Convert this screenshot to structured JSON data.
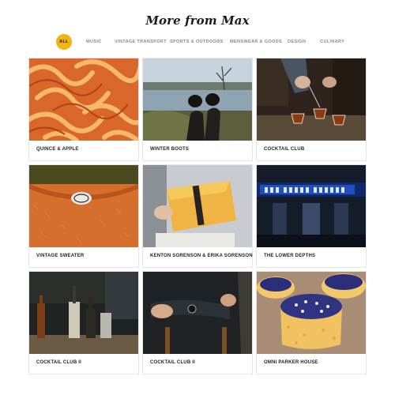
{
  "page": {
    "title": "More from Max"
  },
  "filters": [
    {
      "label": "All",
      "active": true
    },
    {
      "label": "Music",
      "active": false
    },
    {
      "label": "Vintage Transport",
      "active": false
    },
    {
      "label": "Sports & Outdoors",
      "active": false
    },
    {
      "label": "Menswear & Goods",
      "active": false
    },
    {
      "label": "Design",
      "active": false
    },
    {
      "label": "Culinary",
      "active": false
    }
  ],
  "accent_color": "#f2b50f",
  "cards": [
    {
      "title": "Quince & Apple",
      "image": "orange-peel-strips"
    },
    {
      "title": "Winter Boots",
      "image": "boots-by-lake"
    },
    {
      "title": "Cocktail Club",
      "image": "pouring-cocktails"
    },
    {
      "title": "Vintage Sweater",
      "image": "orange-sweater-label"
    },
    {
      "title": "Kenton Sorenson & Erika Sorenson",
      "image": "leather-clutch"
    },
    {
      "title": "The Lower Depths",
      "image": "neon-bar-sign"
    },
    {
      "title": "Cocktail Club II",
      "image": "bar-bottles"
    },
    {
      "title": "Cocktail Club II",
      "image": "man-with-watch"
    },
    {
      "title": "Omni Parker House",
      "image": "blueberry-pastries"
    }
  ]
}
